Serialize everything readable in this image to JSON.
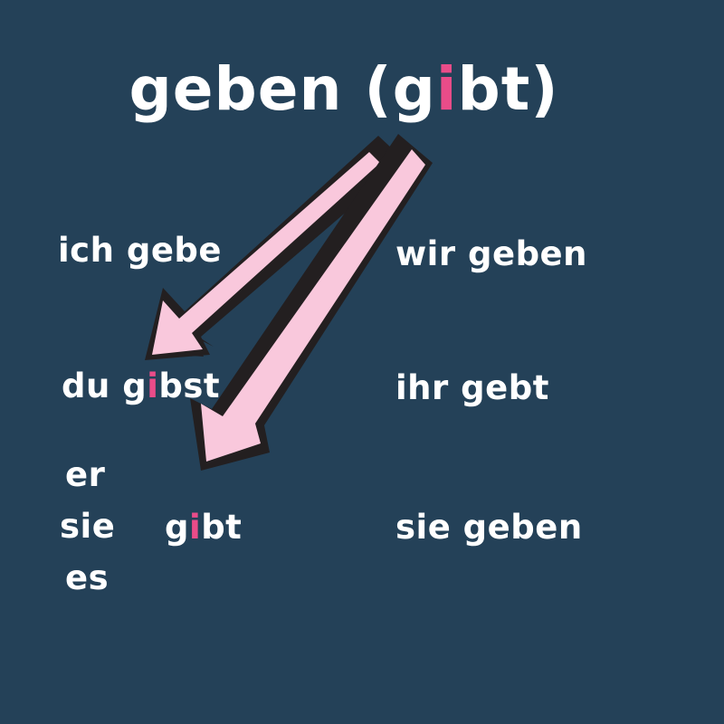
{
  "colors": {
    "background": "#244158",
    "text": "#ffffff",
    "highlight": "#ea4c89",
    "arrow_fill": "#f9c8dc",
    "arrow_shadow": "#231f20"
  },
  "title": {
    "prefix": "geben (",
    "stem_start": "g",
    "vowel": "i",
    "stem_end": "bt)"
  },
  "forms": {
    "ich": "ich gebe",
    "du": {
      "pronoun": "du ",
      "start": "g",
      "vowel": "i",
      "end": "bst"
    },
    "er_sie_es": {
      "start": "g",
      "vowel": "i",
      "end": "bt"
    },
    "wir": "wir geben",
    "ihr": "ihr gebt",
    "sie_plural": "sie geben"
  },
  "pronouns": {
    "er": "er",
    "sie": "sie",
    "es": "es"
  },
  "arrows": [
    {
      "icon": "arrow-down-left",
      "from": "title",
      "to": "du"
    },
    {
      "icon": "arrow-down-left",
      "from": "title",
      "to": "er_sie_es"
    }
  ]
}
